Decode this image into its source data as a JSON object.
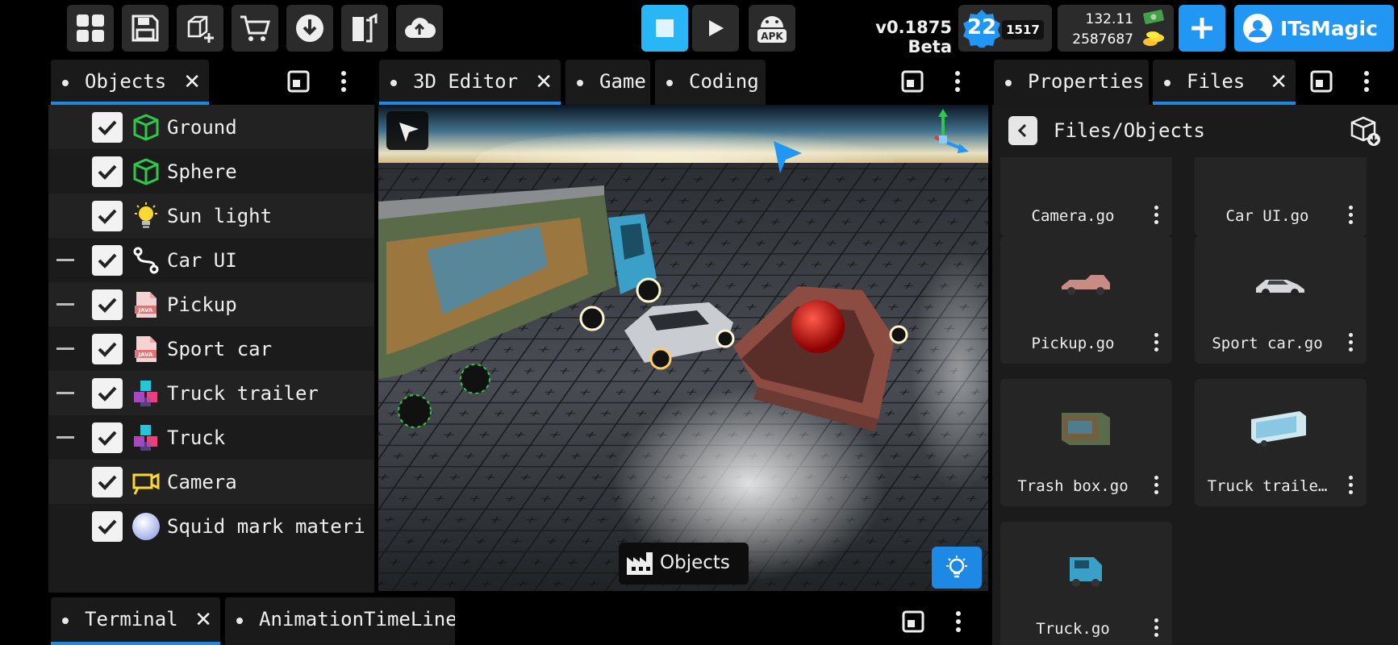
{
  "toolbar": {
    "buttons": [
      "grid-icon",
      "save-icon",
      "add-object-icon",
      "cart-icon",
      "download-icon",
      "export-icon",
      "cloud-upload-icon"
    ],
    "apk_label": "APK",
    "version": "v0.1875 Beta",
    "level": "22",
    "xp": "1517",
    "cash": "132.11",
    "coins": "2587687",
    "username": "ITsMagic",
    "accent_color": "#2196f3",
    "run_color": "#29b6f6"
  },
  "objects_panel": {
    "tab_label": "Objects",
    "items": [
      {
        "label": "Ground",
        "icon": "mesh-icon",
        "collapsible": false
      },
      {
        "label": "Sphere",
        "icon": "mesh-icon",
        "collapsible": false
      },
      {
        "label": "Sun light",
        "icon": "light-bulb-icon",
        "collapsible": false
      },
      {
        "label": "Car UI",
        "icon": "node-icon",
        "collapsible": true
      },
      {
        "label": "Pickup",
        "icon": "java-file-icon",
        "collapsible": true
      },
      {
        "label": "Sport car",
        "icon": "java-file-icon",
        "collapsible": true
      },
      {
        "label": "Truck trailer",
        "icon": "cubes-icon",
        "collapsible": true
      },
      {
        "label": "Truck",
        "icon": "cubes-icon",
        "collapsible": true
      },
      {
        "label": "Camera",
        "icon": "camera-icon",
        "collapsible": false
      },
      {
        "label": "Squid mark materi",
        "icon": "sphere-material-icon",
        "collapsible": false
      }
    ]
  },
  "editor_panel": {
    "tabs": [
      "3D Editor",
      "Game",
      "Coding"
    ],
    "objects_button": "Objects"
  },
  "files_panel": {
    "tabs": [
      "Properties",
      "Files"
    ],
    "path": "Files/Objects",
    "files": [
      {
        "name": "Camera.go",
        "thumb": "none"
      },
      {
        "name": "Car UI.go",
        "thumb": "none"
      },
      {
        "name": "Pickup.go",
        "thumb": "pickup-icon"
      },
      {
        "name": "Sport car.go",
        "thumb": "sport-car-icon"
      },
      {
        "name": "Trash box.go",
        "thumb": "trash-box-icon"
      },
      {
        "name": "Truck traile…",
        "thumb": "trailer-icon"
      },
      {
        "name": "Truck.go",
        "thumb": "truck-icon"
      }
    ]
  },
  "bottom_panel": {
    "tabs": [
      "Terminal",
      "AnimationTimeLine"
    ]
  }
}
